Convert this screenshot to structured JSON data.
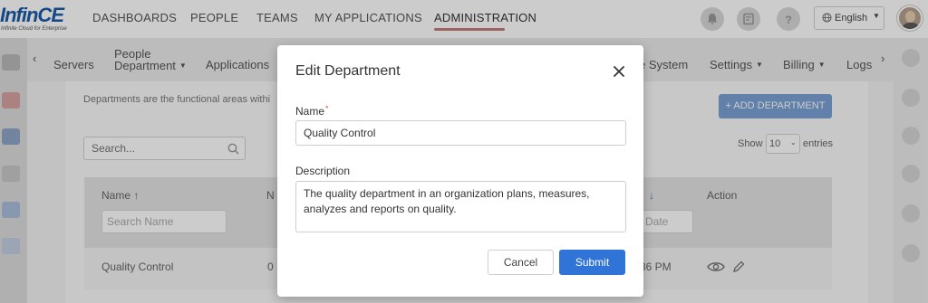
{
  "brand": {
    "name": "InfinCE",
    "tagline": "Infinite Cloud for Enterprise"
  },
  "top_nav": [
    {
      "label": "DASHBOARDS",
      "active": false
    },
    {
      "label": "PEOPLE",
      "active": false
    },
    {
      "label": "TEAMS",
      "active": false
    },
    {
      "label": "MY APPLICATIONS",
      "active": false
    },
    {
      "label": "ADMINISTRATION",
      "active": true
    }
  ],
  "header_icons": [
    "bell-icon",
    "notification-icon",
    "help-icon"
  ],
  "language": {
    "label": "English",
    "icon": "globe-icon"
  },
  "sub_nav": {
    "items": [
      {
        "label": "Servers"
      },
      {
        "label_line1": "People",
        "label_line2": "Department",
        "has_dropdown": true
      },
      {
        "label": "Applications"
      },
      {
        "label": "e System"
      },
      {
        "label": "Settings",
        "has_dropdown": true
      },
      {
        "label": "Billing",
        "has_dropdown": true
      },
      {
        "label": "Logs"
      }
    ]
  },
  "page": {
    "intro": "Departments are the functional areas withi",
    "add_button": "+ ADD DEPARTMENT",
    "search_placeholder": "Search...",
    "show_label": "Show",
    "show_value": "10",
    "entries_label": "entries",
    "table": {
      "col_name": "Name ↑",
      "col_n": "N",
      "col_date_arrow": "↓",
      "col_action": "Action",
      "filter_name_placeholder": "Search Name",
      "filter_date_placeholder": "d Date",
      "rows": [
        {
          "name": "Quality Control",
          "count": "0",
          "time": "36 PM"
        }
      ]
    }
  },
  "modal": {
    "title": "Edit Department",
    "name_label": "Name",
    "required_mark": "*",
    "name_value": "Quality Control",
    "description_label": "Description",
    "description_value": "The quality department in an organization plans, measures, analyzes and reports on quality.",
    "cancel_label": "Cancel",
    "submit_label": "Submit"
  },
  "colors": {
    "primary": "#2f74d6",
    "brand": "#1d5aa8",
    "required": "#d9534f"
  }
}
